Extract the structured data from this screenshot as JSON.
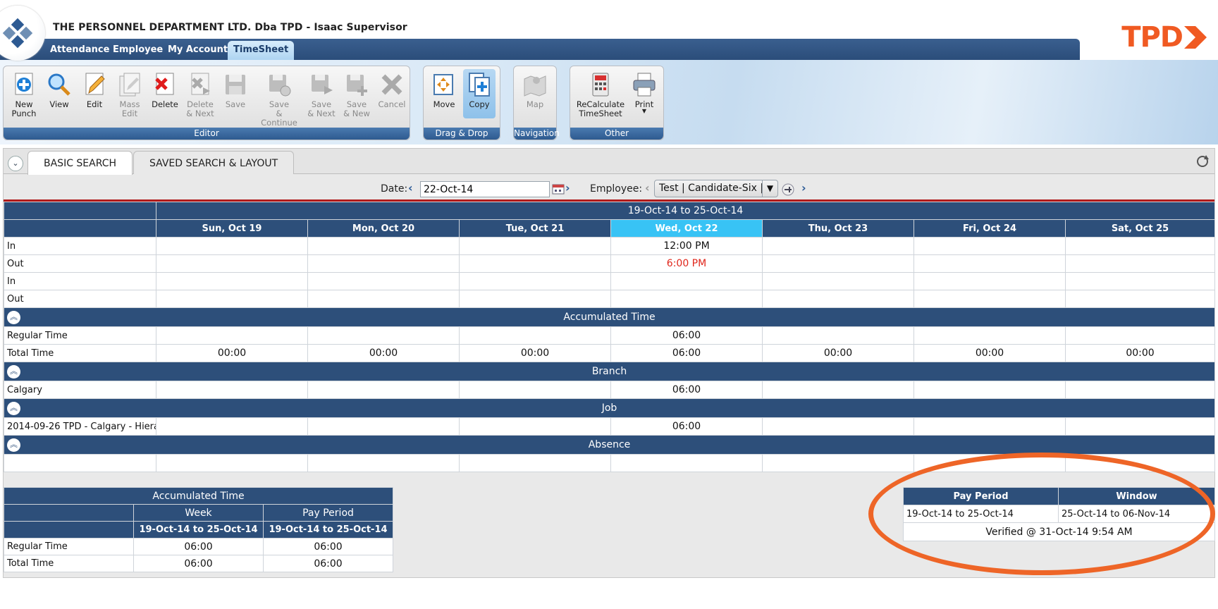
{
  "header": {
    "title": "THE PERSONNEL DEPARTMENT LTD. Dba TPD - Isaac Supervisor",
    "brand": "TPD",
    "nav": [
      "Attendance",
      "Employee",
      "My Account",
      "TimeSheet"
    ]
  },
  "toolbar": {
    "editor": {
      "caption": "Editor",
      "tools": [
        {
          "label": "New\nPunch",
          "icon": "new-punch-icon"
        },
        {
          "label": "View",
          "icon": "magnifier-icon"
        },
        {
          "label": "Edit",
          "icon": "edit-icon"
        },
        {
          "label": "Mass\nEdit",
          "icon": "mass-edit-icon"
        },
        {
          "label": "Delete",
          "icon": "delete-icon"
        },
        {
          "label": "Delete\n& Next",
          "icon": "delete-next-icon"
        },
        {
          "label": "Save",
          "icon": "save-icon"
        },
        {
          "label": "Save\n& Continue",
          "icon": "save-continue-icon"
        },
        {
          "label": "Save\n& Next",
          "icon": "save-next-icon"
        },
        {
          "label": "Save\n& New",
          "icon": "save-new-icon"
        },
        {
          "label": "Cancel",
          "icon": "cancel-icon"
        }
      ]
    },
    "dragdrop": {
      "caption": "Drag & Drop",
      "move": "Move",
      "copy": "Copy"
    },
    "navigation": {
      "caption": "Navigation",
      "map": "Map"
    },
    "other": {
      "caption": "Other",
      "recalc": "ReCalculate\nTimeSheet",
      "print": "Print"
    }
  },
  "search": {
    "tabs": [
      "BASIC SEARCH",
      "SAVED SEARCH & LAYOUT"
    ],
    "date_label": "Date:",
    "date_value": "22-Oct-14",
    "employee_label": "Employee:",
    "employee_value": "Test | Candidate-Six |"
  },
  "timesheet": {
    "range": "19-Oct-14 to 25-Oct-14",
    "days": [
      "Sun, Oct 19",
      "Mon, Oct 20",
      "Tue, Oct 21",
      "Wed, Oct 22",
      "Thu, Oct 23",
      "Fri, Oct 24",
      "Sat, Oct 25"
    ],
    "punch_rows": [
      {
        "label": "In",
        "values": [
          "",
          "",
          "",
          "12:00 PM",
          "",
          "",
          ""
        ]
      },
      {
        "label": "Out",
        "values": [
          "",
          "",
          "",
          "6:00 PM",
          "",
          "",
          ""
        ]
      },
      {
        "label": "In",
        "values": [
          "",
          "",
          "",
          "",
          "",
          "",
          ""
        ]
      },
      {
        "label": "Out",
        "values": [
          "",
          "",
          "",
          "",
          "",
          "",
          ""
        ]
      }
    ],
    "sections": {
      "accumulated": "Accumulated Time",
      "branch": "Branch",
      "job": "Job",
      "absence": "Absence"
    },
    "regular_time": {
      "label": "Regular Time",
      "values": [
        "",
        "",
        "",
        "06:00",
        "",
        "",
        ""
      ]
    },
    "total_time": {
      "label": "Total Time",
      "values": [
        "00:00",
        "00:00",
        "00:00",
        "06:00",
        "00:00",
        "00:00",
        "00:00"
      ]
    },
    "branch_row": {
      "label": "Calgary",
      "values": [
        "",
        "",
        "",
        "06:00",
        "",
        "",
        ""
      ]
    },
    "job_row": {
      "label": "2014-09-26 TPD - Calgary - Hierar",
      "values": [
        "",
        "",
        "",
        "06:00",
        "",
        "",
        ""
      ]
    }
  },
  "accumulated_summary": {
    "title": "Accumulated Time",
    "week_label": "Week",
    "pay_period_label": "Pay Period",
    "week_range": "19-Oct-14 to 25-Oct-14",
    "pay_period_range": "19-Oct-14 to 25-Oct-14",
    "rows": [
      {
        "label": "Regular Time",
        "week": "06:00",
        "pay_period": "06:00"
      },
      {
        "label": "Total Time",
        "week": "06:00",
        "pay_period": "06:00"
      }
    ]
  },
  "pay_period_info": {
    "pay_period_header": "Pay Period",
    "window_header": "Window",
    "pay_period": "19-Oct-14 to 25-Oct-14",
    "window": "25-Oct-14 to 06-Nov-14",
    "verified": "Verified @ 31-Oct-14 9:54 AM"
  },
  "colors": {
    "navy": "#2d4f7a",
    "today": "#38c3f5",
    "brand": "#f05a22",
    "highlight": "#ee6527",
    "out_punch": "#e0261b"
  }
}
